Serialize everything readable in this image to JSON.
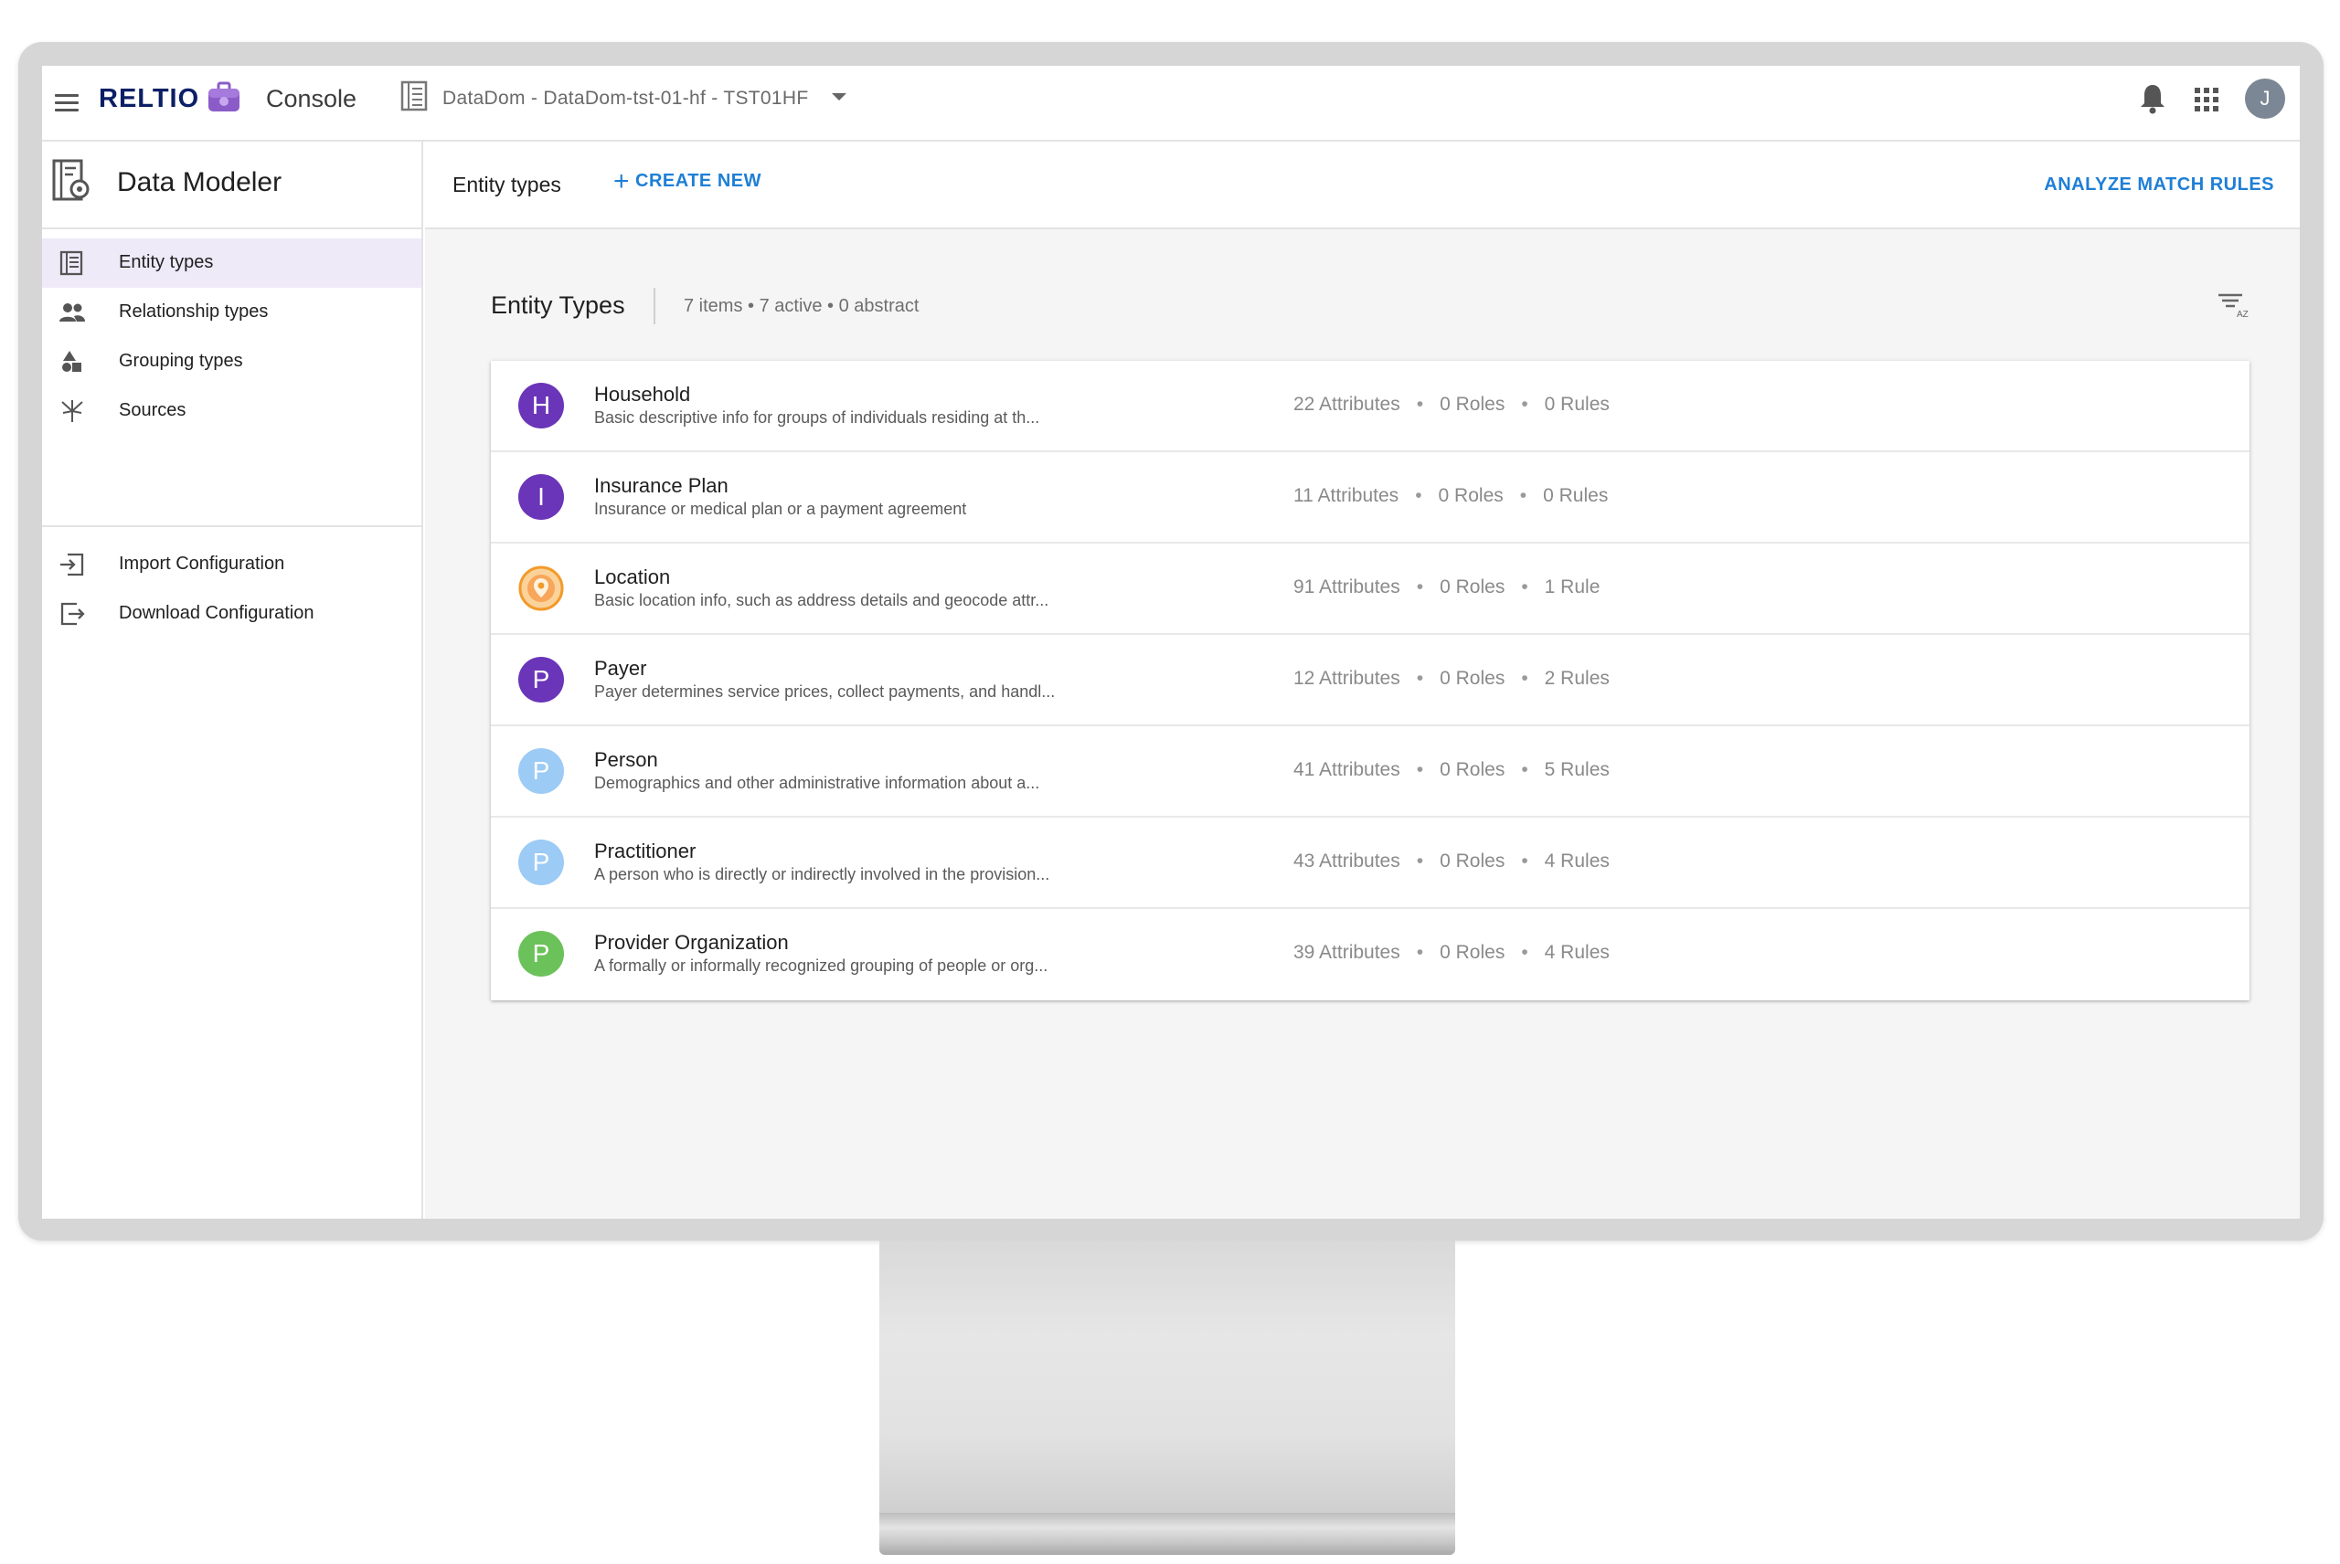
{
  "topbar": {
    "brand": "RELTIO",
    "app_name": "Console",
    "tenant": "DataDom - DataDom-tst-01-hf - TST01HF",
    "avatar_initial": "J"
  },
  "sidebar": {
    "title": "Data Modeler",
    "items": [
      {
        "label": "Entity types",
        "icon": "entity-types-icon",
        "active": true
      },
      {
        "label": "Relationship types",
        "icon": "people-icon",
        "active": false
      },
      {
        "label": "Grouping types",
        "icon": "shapes-icon",
        "active": false
      },
      {
        "label": "Sources",
        "icon": "sources-icon",
        "active": false
      }
    ],
    "config_items": [
      {
        "label": "Import Configuration",
        "icon": "import-icon"
      },
      {
        "label": "Download Configuration",
        "icon": "download-icon"
      }
    ]
  },
  "toolbar": {
    "title": "Entity types",
    "create_new": "CREATE NEW",
    "analyze": "ANALYZE MATCH RULES"
  },
  "list": {
    "title": "Entity Types",
    "meta": "7 items • 7 active • 0 abstract",
    "dot": "•",
    "rows": [
      {
        "initial": "H",
        "color": "#6a35b8",
        "name": "Household",
        "desc": "Basic descriptive info for groups of individuals residing at th...",
        "attributes": "22 Attributes",
        "roles": "0 Roles",
        "rules": "0 Rules"
      },
      {
        "initial": "I",
        "color": "#6a35b8",
        "name": "Insurance Plan",
        "desc": "Insurance or medical plan or a payment agreement",
        "attributes": "11 Attributes",
        "roles": "0 Roles",
        "rules": "0 Rules"
      },
      {
        "initial": "",
        "color": "#f4a13a",
        "name": "Location",
        "desc": "Basic location info, such as address details and geocode attr...",
        "attributes": "91 Attributes",
        "roles": "0 Roles",
        "rules": "1 Rule"
      },
      {
        "initial": "P",
        "color": "#6a35b8",
        "name": "Payer",
        "desc": "Payer determines service prices, collect payments, and handl...",
        "attributes": "12 Attributes",
        "roles": "0 Roles",
        "rules": "2 Rules"
      },
      {
        "initial": "P",
        "color": "#9ccbf5",
        "name": "Person",
        "desc": "Demographics and other administrative information about a...",
        "attributes": "41 Attributes",
        "roles": "0 Roles",
        "rules": "5 Rules"
      },
      {
        "initial": "P",
        "color": "#9ccbf5",
        "name": "Practitioner",
        "desc": "A person who is directly or indirectly involved in the provision...",
        "attributes": "43 Attributes",
        "roles": "0 Roles",
        "rules": "4 Rules"
      },
      {
        "initial": "P",
        "color": "#6cc25a",
        "name": "Provider Organization",
        "desc": "A formally or informally recognized grouping of people or org...",
        "attributes": "39 Attributes",
        "roles": "0 Roles",
        "rules": "4 Rules"
      }
    ]
  }
}
